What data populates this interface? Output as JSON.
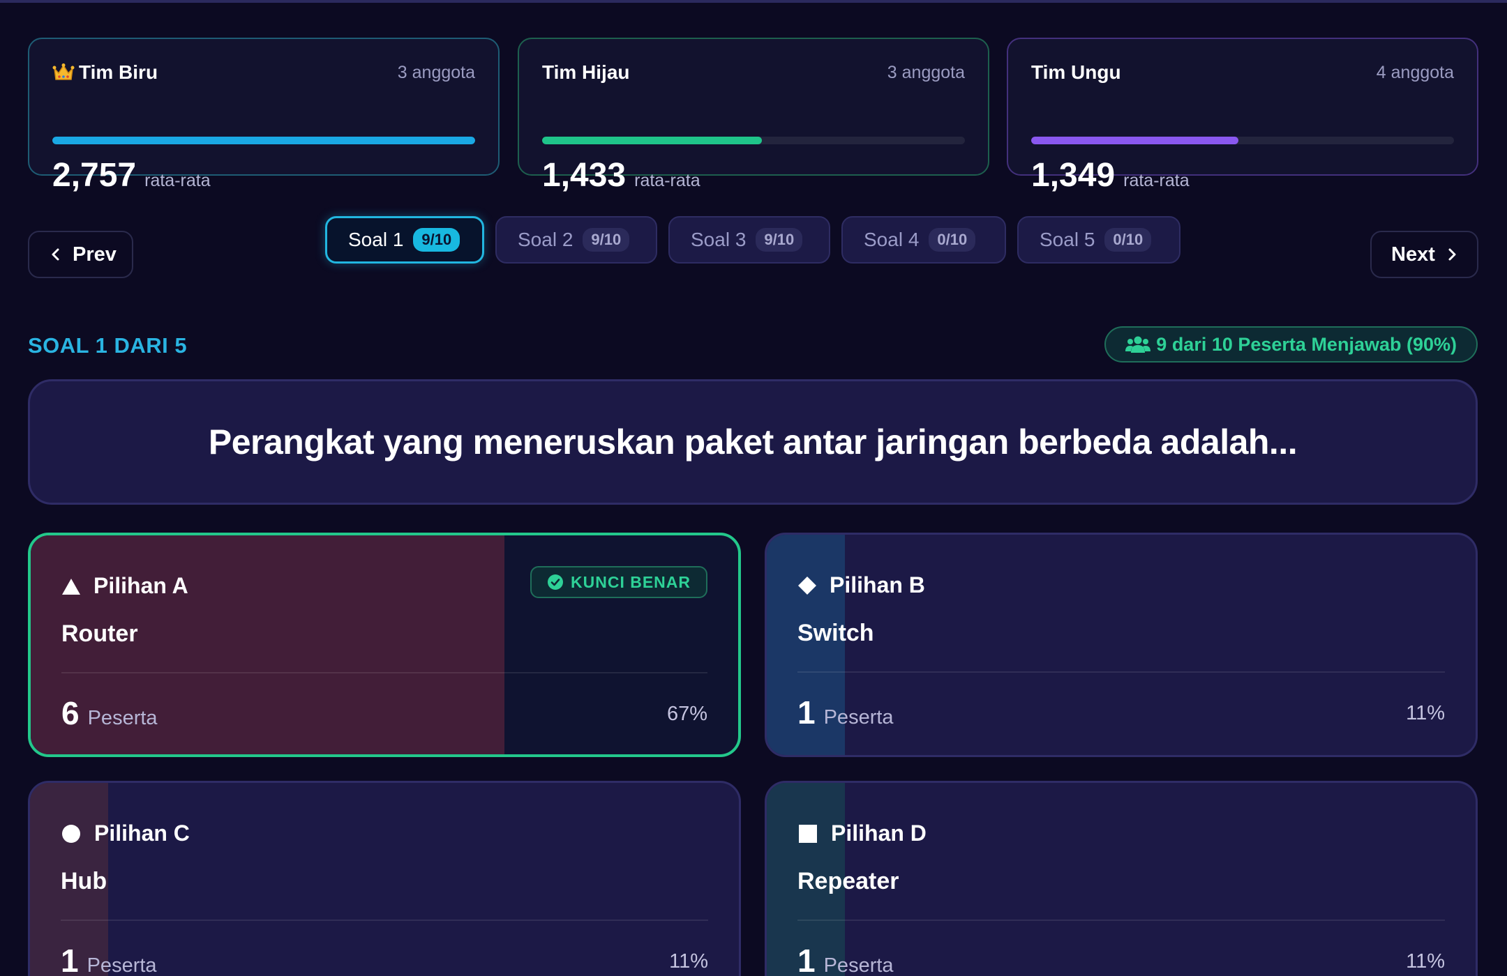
{
  "teams": [
    {
      "name": "Tim Biru",
      "crown": true,
      "members": "3 anggota",
      "score": "2,757",
      "score_label": "rata-rata",
      "progress": 1.0,
      "color": "#1aa8e4"
    },
    {
      "name": "Tim Hijau",
      "crown": false,
      "members": "3 anggota",
      "score": "1,433",
      "score_label": "rata-rata",
      "progress": 0.52,
      "color": "#1fc48a"
    },
    {
      "name": "Tim Ungu",
      "crown": false,
      "members": "4 anggota",
      "score": "1,349",
      "score_label": "rata-rata",
      "progress": 0.49,
      "color": "#8a58f0"
    }
  ],
  "nav": {
    "prev": "Prev",
    "next": "Next"
  },
  "tabs": [
    {
      "label": "Soal 1",
      "badge": "9/10",
      "active": true
    },
    {
      "label": "Soal 2",
      "badge": "9/10",
      "active": false
    },
    {
      "label": "Soal 3",
      "badge": "9/10",
      "active": false
    },
    {
      "label": "Soal 4",
      "badge": "0/10",
      "active": false
    },
    {
      "label": "Soal 5",
      "badge": "0/10",
      "active": false
    }
  ],
  "question": {
    "label": "SOAL 1 DARI 5",
    "answered": "9 dari 10 Peserta Menjawab (90%)",
    "text": "Perangkat yang meneruskan paket antar jaringan berbeda adalah..."
  },
  "options": [
    {
      "title": "Pilihan A",
      "shape": "triangle-icon",
      "answer": "Router",
      "count": "6",
      "count_label": "Peserta",
      "percent": "67%",
      "fraction": 0.67,
      "correct": true,
      "correct_label": "KUNCI BENAR",
      "fill_color": "#421e38"
    },
    {
      "title": "Pilihan B",
      "shape": "diamond-icon",
      "answer": "Switch",
      "count": "1",
      "count_label": "Peserta",
      "percent": "11%",
      "fraction": 0.11,
      "correct": false,
      "fill_color": "#1b3766"
    },
    {
      "title": "Pilihan C",
      "shape": "circle-icon",
      "answer": "Hub",
      "count": "1",
      "count_label": "Peserta",
      "percent": "11%",
      "fraction": 0.11,
      "correct": false,
      "fill_color": "#3a2440"
    },
    {
      "title": "Pilihan D",
      "shape": "square-icon",
      "answer": "Repeater",
      "count": "1",
      "count_label": "Peserta",
      "percent": "11%",
      "fraction": 0.11,
      "correct": false,
      "fill_color": "#19364e"
    }
  ]
}
